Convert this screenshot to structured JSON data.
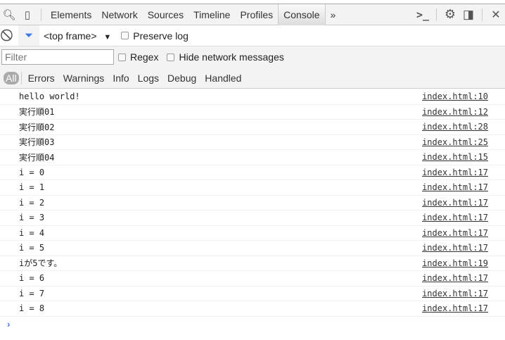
{
  "tabs": [
    "Elements",
    "Network",
    "Sources",
    "Timeline",
    "Profiles",
    "Console"
  ],
  "more": "»",
  "toolbar": {
    "frame": "<top frame>",
    "preserve_log": "Preserve log"
  },
  "filter": {
    "placeholder": "Filter",
    "regex": "Regex",
    "hide_network": "Hide network messages"
  },
  "levels": [
    "All",
    "Errors",
    "Warnings",
    "Info",
    "Logs",
    "Debug",
    "Handled"
  ],
  "messages": [
    {
      "text": "hello world!",
      "source": "index.html:10"
    },
    {
      "text": "実行順01",
      "source": "index.html:12"
    },
    {
      "text": "実行順02",
      "source": "index.html:28"
    },
    {
      "text": "実行順03",
      "source": "index.html:25"
    },
    {
      "text": "実行順04",
      "source": "index.html:15"
    },
    {
      "text": "i = 0",
      "source": "index.html:17"
    },
    {
      "text": "i = 1",
      "source": "index.html:17"
    },
    {
      "text": "i = 2",
      "source": "index.html:17"
    },
    {
      "text": "i = 3",
      "source": "index.html:17"
    },
    {
      "text": "i = 4",
      "source": "index.html:17"
    },
    {
      "text": "i = 5",
      "source": "index.html:17"
    },
    {
      "text": "iが5です。",
      "source": "index.html:19"
    },
    {
      "text": "i = 6",
      "source": "index.html:17"
    },
    {
      "text": "i = 7",
      "source": "index.html:17"
    },
    {
      "text": "i = 8",
      "source": "index.html:17"
    }
  ],
  "prompt": "›"
}
